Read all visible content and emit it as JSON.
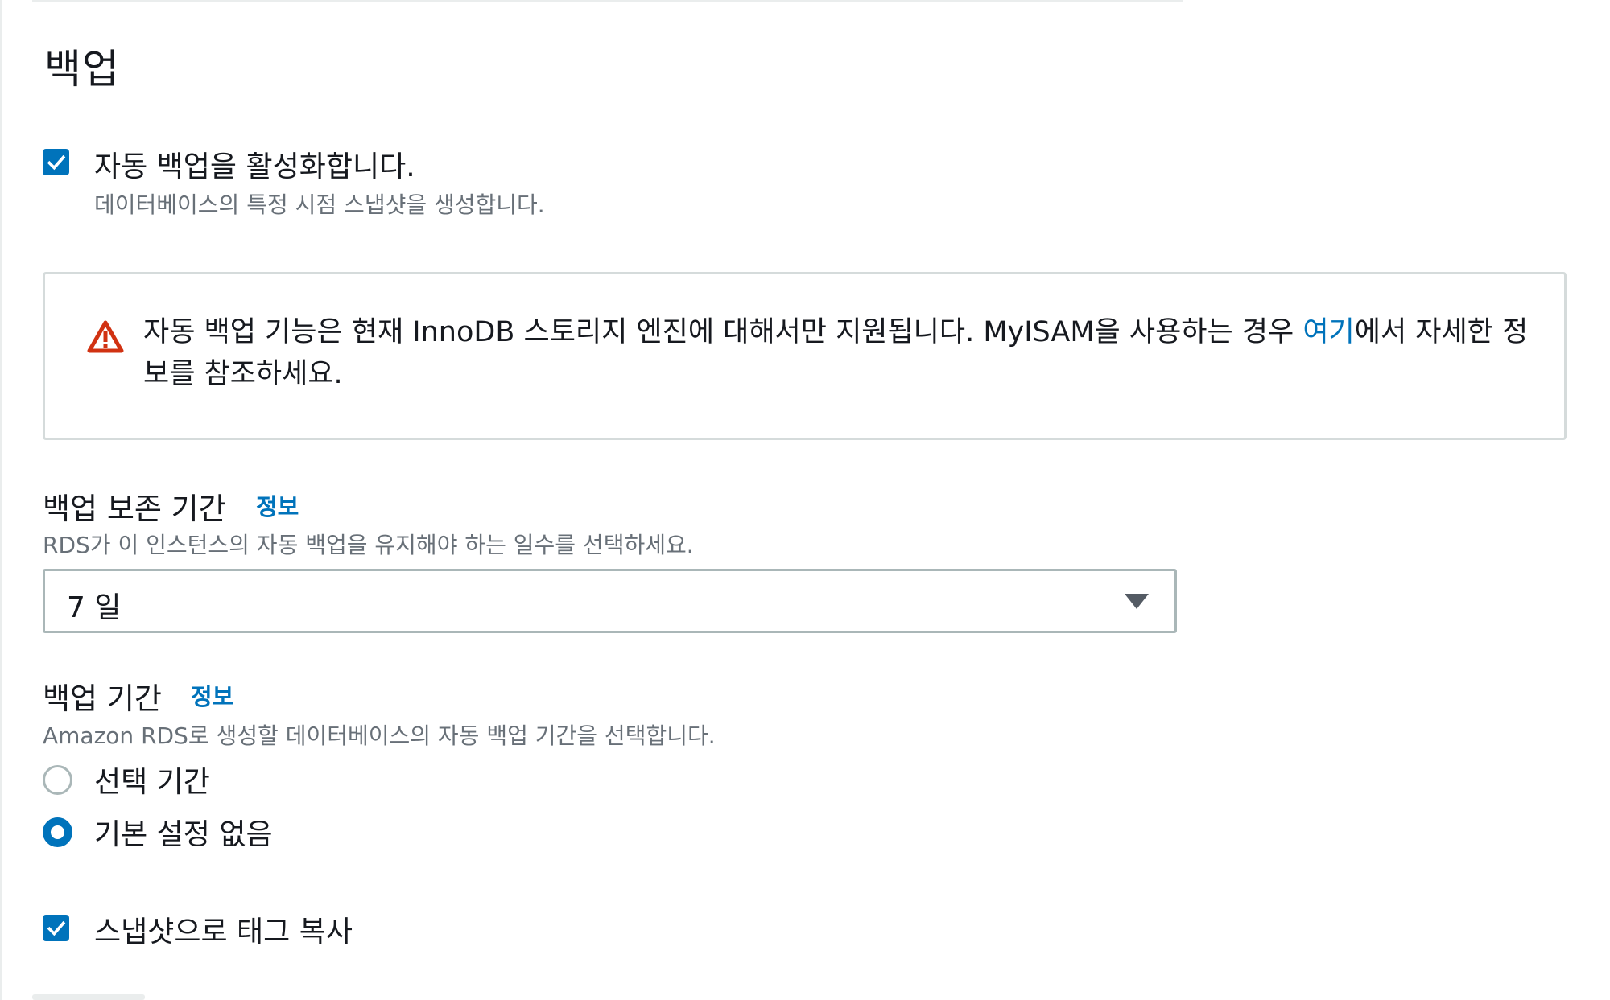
{
  "section": {
    "title": "백업"
  },
  "auto_backup": {
    "checked": true,
    "label": "자동 백업을 활성화합니다.",
    "description": "데이터베이스의 특정 시점 스냅샷을 생성합니다."
  },
  "alert": {
    "icon": "warning-triangle-icon",
    "icon_color": "#d13212",
    "text_before_link": "자동 백업 기능은 현재 InnoDB 스토리지 엔진에 대해서만 지원됩니다. MyISAM을 사용하는 경우 ",
    "link_text": "여기",
    "text_after_link": "에서 자세한 정보를 참조하세요."
  },
  "retention": {
    "label": "백업 보존 기간",
    "info_link": "정보",
    "description": "RDS가 이 인스턴스의 자동 백업을 유지해야 하는 일수를 선택하세요.",
    "selected_value": "7 일"
  },
  "backup_window": {
    "label": "백업 기간",
    "info_link": "정보",
    "description": "Amazon RDS로 생성할 데이터베이스의 자동 백업 기간을 선택합니다.",
    "options": [
      {
        "label": "선택 기간",
        "selected": false
      },
      {
        "label": "기본 설정 없음",
        "selected": true
      }
    ]
  },
  "copy_tags": {
    "checked": true,
    "label": "스냅샷으로 태그 복사"
  },
  "colors": {
    "accent": "#0073bb",
    "text_primary": "#16191f",
    "text_secondary": "#687078",
    "border": "#aab7b8",
    "warning": "#d13212"
  }
}
